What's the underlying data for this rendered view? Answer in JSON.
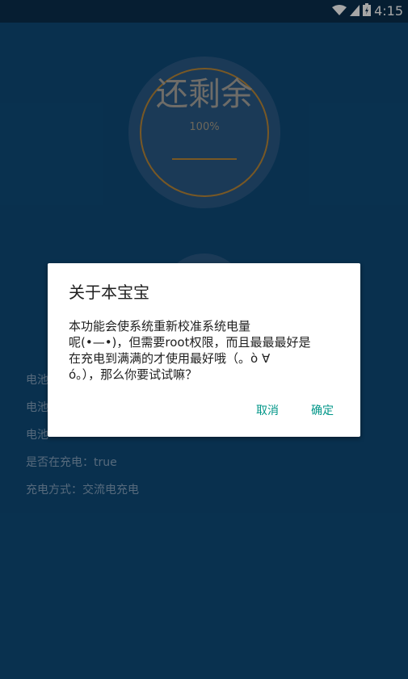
{
  "status_bar": {
    "time": "4:15",
    "icons": [
      "wifi-icon",
      "signal-icon",
      "battery-icon"
    ]
  },
  "gauge": {
    "title": "还剩余",
    "percent": "100%"
  },
  "info_lines": [
    "电池",
    "电池",
    "电池",
    "是否在充电：true",
    "充电方式：交流电充电"
  ],
  "dialog": {
    "title": "关于本宝宝",
    "message_lines": [
      "本功能会使系统重新校准系统电量",
      "呢(•—•)，但需要root权限，而且最最最好是",
      "在充电到满满的才使用最好哦（。ò ∀",
      "ó。），那么你要试试嘛？"
    ],
    "cancel_label": "取消",
    "ok_label": "确定"
  },
  "colors": {
    "background": "#0d4a78",
    "dialog_bg": "#ffffff",
    "accent": "#009688"
  }
}
